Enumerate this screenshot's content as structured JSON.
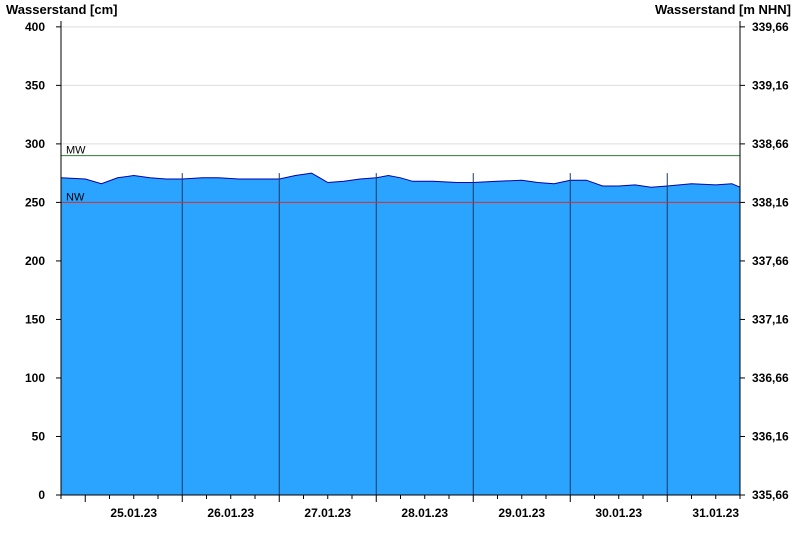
{
  "chart_data": {
    "type": "area",
    "left_axis_label": "Wasserstand [cm]",
    "right_axis_label": "Wasserstand [m NHN]",
    "ylim": [
      0,
      405
    ],
    "y_ticks": [
      0,
      50,
      100,
      150,
      200,
      250,
      300,
      350,
      400
    ],
    "right_ticks": [
      "335,66",
      "336,16",
      "336,66",
      "337,16",
      "337,66",
      "338,16",
      "338,66",
      "339,16",
      "339,66"
    ],
    "x_start": "2023-01-24T18:00",
    "x_end": "2023-01-31T18:00",
    "day_boundaries": [
      "2023-01-25T00:00",
      "2023-01-26T00:00",
      "2023-01-27T00:00",
      "2023-01-28T00:00",
      "2023-01-29T00:00",
      "2023-01-30T00:00",
      "2023-01-31T00:00"
    ],
    "day_labels": [
      "25.01.23",
      "26.01.23",
      "27.01.23",
      "28.01.23",
      "29.01.23",
      "30.01.23",
      "31.01.23"
    ],
    "reference_lines": [
      {
        "label": "MW",
        "value": 290,
        "color": "#2e7d32"
      },
      {
        "label": "NW",
        "value": 250,
        "color": "#d32f2f"
      }
    ],
    "series": [
      {
        "fill_color": "#2aa4ff",
        "line_color": "#0000aa",
        "points": [
          [
            "2023-01-24T18:00",
            271
          ],
          [
            "2023-01-25T00:00",
            270
          ],
          [
            "2023-01-25T04:00",
            266
          ],
          [
            "2023-01-25T08:00",
            271
          ],
          [
            "2023-01-25T12:00",
            273
          ],
          [
            "2023-01-25T16:00",
            271
          ],
          [
            "2023-01-25T20:00",
            270
          ],
          [
            "2023-01-26T00:00",
            270
          ],
          [
            "2023-01-26T05:00",
            271
          ],
          [
            "2023-01-26T09:00",
            271
          ],
          [
            "2023-01-26T14:00",
            270
          ],
          [
            "2023-01-26T20:00",
            270
          ],
          [
            "2023-01-27T00:00",
            270
          ],
          [
            "2023-01-27T04:00",
            273
          ],
          [
            "2023-01-27T08:00",
            275
          ],
          [
            "2023-01-27T10:00",
            271
          ],
          [
            "2023-01-27T12:00",
            267
          ],
          [
            "2023-01-27T16:00",
            268
          ],
          [
            "2023-01-27T20:00",
            270
          ],
          [
            "2023-01-28T00:00",
            271
          ],
          [
            "2023-01-28T03:00",
            273
          ],
          [
            "2023-01-28T06:00",
            271
          ],
          [
            "2023-01-28T09:00",
            268
          ],
          [
            "2023-01-28T14:00",
            268
          ],
          [
            "2023-01-28T20:00",
            267
          ],
          [
            "2023-01-29T00:00",
            267
          ],
          [
            "2023-01-29T06:00",
            268
          ],
          [
            "2023-01-29T12:00",
            269
          ],
          [
            "2023-01-29T16:00",
            267
          ],
          [
            "2023-01-29T20:00",
            266
          ],
          [
            "2023-01-30T00:00",
            269
          ],
          [
            "2023-01-30T04:00",
            269
          ],
          [
            "2023-01-30T08:00",
            264
          ],
          [
            "2023-01-30T12:00",
            264
          ],
          [
            "2023-01-30T16:00",
            265
          ],
          [
            "2023-01-30T20:00",
            263
          ],
          [
            "2023-01-31T00:00",
            264
          ],
          [
            "2023-01-31T06:00",
            266
          ],
          [
            "2023-01-31T12:00",
            265
          ],
          [
            "2023-01-31T16:00",
            266
          ],
          [
            "2023-01-31T18:00",
            263
          ]
        ]
      }
    ]
  }
}
